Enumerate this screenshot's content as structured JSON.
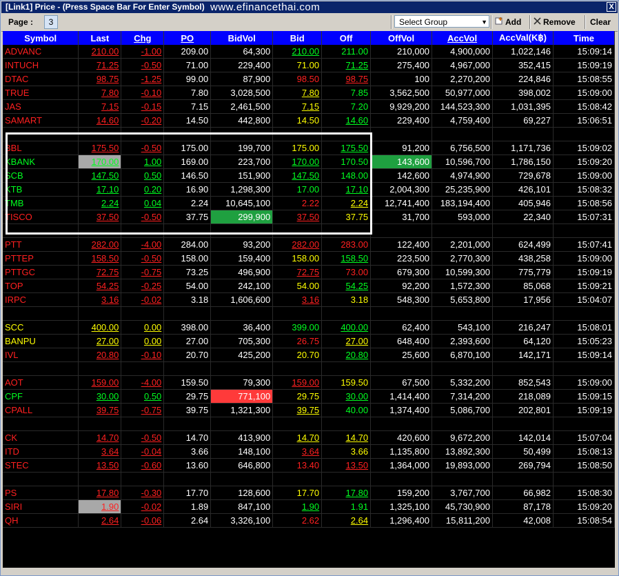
{
  "window": {
    "title": "[Link1] Price  - (Press Space Bar For Enter Symbol)",
    "watermark": "www.efinancethai.com",
    "close_label": "X"
  },
  "toolbar": {
    "page_label": "Page :",
    "page_value": "3",
    "group_placeholder": "Select Group",
    "add_label": "Add",
    "remove_label": "Remove",
    "clear_label": "Clear"
  },
  "columns": [
    "Symbol",
    "Last",
    "Chg",
    "PO",
    "BidVol",
    "Bid",
    "Off",
    "OffVol",
    "AccVol",
    "AccVal(K฿)",
    "Time"
  ],
  "underlined_columns": [
    "Chg",
    "PO",
    "AccVol"
  ],
  "colors": {
    "up": "#00ff20",
    "down": "#ff2020",
    "unchanged": "#ffff00",
    "header_bg": "#0000ff"
  },
  "rows": [
    [
      "ADVANC",
      "210.00",
      "-1.00",
      "209.00",
      "64,300",
      "210.00",
      "211.00",
      "210,000",
      "4,900,000",
      "1,022,146",
      "15:09:14"
    ],
    [
      "INTUCH",
      "71.25",
      "-0.50",
      "71.00",
      "229,400",
      "71.00",
      "71.25",
      "275,400",
      "4,967,000",
      "352,415",
      "15:09:19"
    ],
    [
      "DTAC",
      "98.75",
      "-1.25",
      "99.00",
      "87,900",
      "98.50",
      "98.75",
      "100",
      "2,270,200",
      "224,846",
      "15:08:55"
    ],
    [
      "TRUE",
      "7.80",
      "-0.10",
      "7.80",
      "3,028,500",
      "7.80",
      "7.85",
      "3,562,500",
      "50,977,000",
      "398,002",
      "15:09:00"
    ],
    [
      "JAS",
      "7.15",
      "-0.15",
      "7.15",
      "2,461,500",
      "7.15",
      "7.20",
      "9,929,200",
      "144,523,300",
      "1,031,395",
      "15:08:42"
    ],
    [
      "SAMART",
      "14.60",
      "-0.20",
      "14.50",
      "442,800",
      "14.50",
      "14.60",
      "229,400",
      "4,759,400",
      "69,227",
      "15:06:51"
    ],
    [
      "",
      "",
      "",
      "",
      "",
      "",
      "",
      "",
      "",
      "",
      ""
    ],
    [
      "BBL",
      "175.50",
      "-0.50",
      "175.00",
      "199,700",
      "175.00",
      "175.50",
      "91,200",
      "6,756,500",
      "1,171,736",
      "15:09:02"
    ],
    [
      "KBANK",
      "170.00",
      "1.00",
      "169.00",
      "223,700",
      "170.00",
      "170.50",
      "143,600",
      "10,596,700",
      "1,786,150",
      "15:09:20"
    ],
    [
      "SCB",
      "147.50",
      "0.50",
      "146.50",
      "151,900",
      "147.50",
      "148.00",
      "142,600",
      "4,974,900",
      "729,678",
      "15:09:00"
    ],
    [
      "KTB",
      "17.10",
      "0.20",
      "16.90",
      "1,298,300",
      "17.00",
      "17.10",
      "2,004,300",
      "25,235,900",
      "426,101",
      "15:08:32"
    ],
    [
      "TMB",
      "2.24",
      "0.04",
      "2.24",
      "10,645,100",
      "2.22",
      "2.24",
      "12,741,400",
      "183,194,400",
      "405,946",
      "15:08:56"
    ],
    [
      "TISCO",
      "37.50",
      "-0.50",
      "37.75",
      "299,900",
      "37.50",
      "37.75",
      "31,700",
      "593,000",
      "22,340",
      "15:07:31"
    ],
    [
      "",
      "",
      "",
      "",
      "",
      "",
      "",
      "",
      "",
      "",
      ""
    ],
    [
      "PTT",
      "282.00",
      "-4.00",
      "284.00",
      "93,200",
      "282.00",
      "283.00",
      "122,400",
      "2,201,000",
      "624,499",
      "15:07:41"
    ],
    [
      "PTTEP",
      "158.50",
      "-0.50",
      "158.00",
      "159,400",
      "158.00",
      "158.50",
      "223,500",
      "2,770,300",
      "438,258",
      "15:09:00"
    ],
    [
      "PTTGC",
      "72.75",
      "-0.75",
      "73.25",
      "496,900",
      "72.75",
      "73.00",
      "679,300",
      "10,599,300",
      "775,779",
      "15:09:19"
    ],
    [
      "TOP",
      "54.25",
      "-0.25",
      "54.00",
      "242,100",
      "54.00",
      "54.25",
      "92,200",
      "1,572,300",
      "85,068",
      "15:09:21"
    ],
    [
      "IRPC",
      "3.16",
      "-0.02",
      "3.18",
      "1,606,600",
      "3.16",
      "3.18",
      "548,300",
      "5,653,800",
      "17,956",
      "15:04:07"
    ],
    [
      "",
      "",
      "",
      "",
      "",
      "",
      "",
      "",
      "",
      "",
      ""
    ],
    [
      "SCC",
      "400.00",
      "0.00",
      "398.00",
      "36,400",
      "399.00",
      "400.00",
      "62,400",
      "543,100",
      "216,247",
      "15:08:01"
    ],
    [
      "BANPU",
      "27.00",
      "0.00",
      "27.00",
      "705,300",
      "26.75",
      "27.00",
      "648,400",
      "2,393,600",
      "64,120",
      "15:05:23"
    ],
    [
      "IVL",
      "20.80",
      "-0.10",
      "20.70",
      "425,200",
      "20.70",
      "20.80",
      "25,600",
      "6,870,100",
      "142,171",
      "15:09:14"
    ],
    [
      "",
      "",
      "",
      "",
      "",
      "",
      "",
      "",
      "",
      "",
      ""
    ],
    [
      "AOT",
      "159.00",
      "-4.00",
      "159.50",
      "79,300",
      "159.00",
      "159.50",
      "67,500",
      "5,332,200",
      "852,543",
      "15:09:00"
    ],
    [
      "CPF",
      "30.00",
      "0.50",
      "29.75",
      "771,100",
      "29.75",
      "30.00",
      "1,414,400",
      "7,314,200",
      "218,089",
      "15:09:15"
    ],
    [
      "CPALL",
      "39.75",
      "-0.75",
      "39.75",
      "1,321,300",
      "39.75",
      "40.00",
      "1,374,400",
      "5,086,700",
      "202,801",
      "15:09:19"
    ],
    [
      "",
      "",
      "",
      "",
      "",
      "",
      "",
      "",
      "",
      "",
      ""
    ],
    [
      "CK",
      "14.70",
      "-0.50",
      "14.70",
      "413,900",
      "14.70",
      "14.70",
      "420,600",
      "9,672,200",
      "142,014",
      "15:07:04"
    ],
    [
      "ITD",
      "3.64",
      "-0.04",
      "3.66",
      "148,100",
      "3.64",
      "3.66",
      "1,135,800",
      "13,892,300",
      "50,499",
      "15:08:13"
    ],
    [
      "STEC",
      "13.50",
      "-0.60",
      "13.60",
      "646,800",
      "13.40",
      "13.50",
      "1,364,000",
      "19,893,000",
      "269,794",
      "15:08:50"
    ],
    [
      "",
      "",
      "",
      "",
      "",
      "",
      "",
      "",
      "",
      "",
      ""
    ],
    [
      "PS",
      "17.80",
      "-0.30",
      "17.70",
      "128,600",
      "17.70",
      "17.80",
      "159,200",
      "3,767,700",
      "66,982",
      "15:08:30"
    ],
    [
      "SIRI",
      "1.90",
      "-0.02",
      "1.89",
      "847,100",
      "1.90",
      "1.91",
      "1,325,100",
      "45,730,900",
      "87,178",
      "15:09:20"
    ],
    [
      "QH",
      "2.64",
      "-0.06",
      "2.64",
      "3,326,100",
      "2.62",
      "2.64",
      "1,296,400",
      "15,811,200",
      "42,008",
      "15:08:54"
    ]
  ]
}
